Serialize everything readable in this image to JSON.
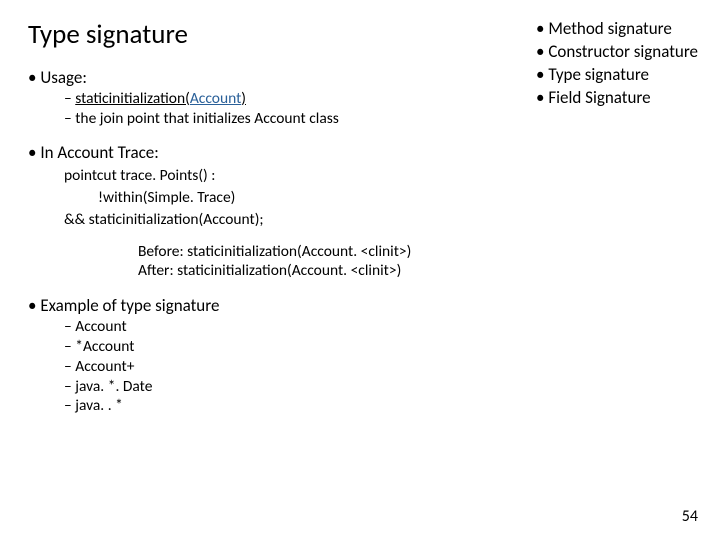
{
  "title": "Type signature",
  "topList": {
    "items": [
      "Method signature",
      "Constructor signature",
      "Type signature",
      "Field Signature"
    ]
  },
  "usage": {
    "label": "Usage:",
    "sub1_pre": "staticinitialization(",
    "sub1_link": "Account",
    "sub1_post": ")",
    "sub2": "the join point that initializes Account class"
  },
  "trace": {
    "label": "In Account Trace:",
    "line1": "pointcut trace. Points() :",
    "line2": "!within(Simple. Trace)",
    "line3": "&&   staticinitialization(Account);"
  },
  "beforeAfter": {
    "before": "Before: staticinitialization(Account. <clinit>)",
    "after": "After: staticinitialization(Account. <clinit>)"
  },
  "example": {
    "label": "Example of type signature",
    "items": [
      "Account",
      "*Account",
      "Account+",
      "java. *. Date",
      "java. . *"
    ]
  },
  "pageNumber": "54"
}
